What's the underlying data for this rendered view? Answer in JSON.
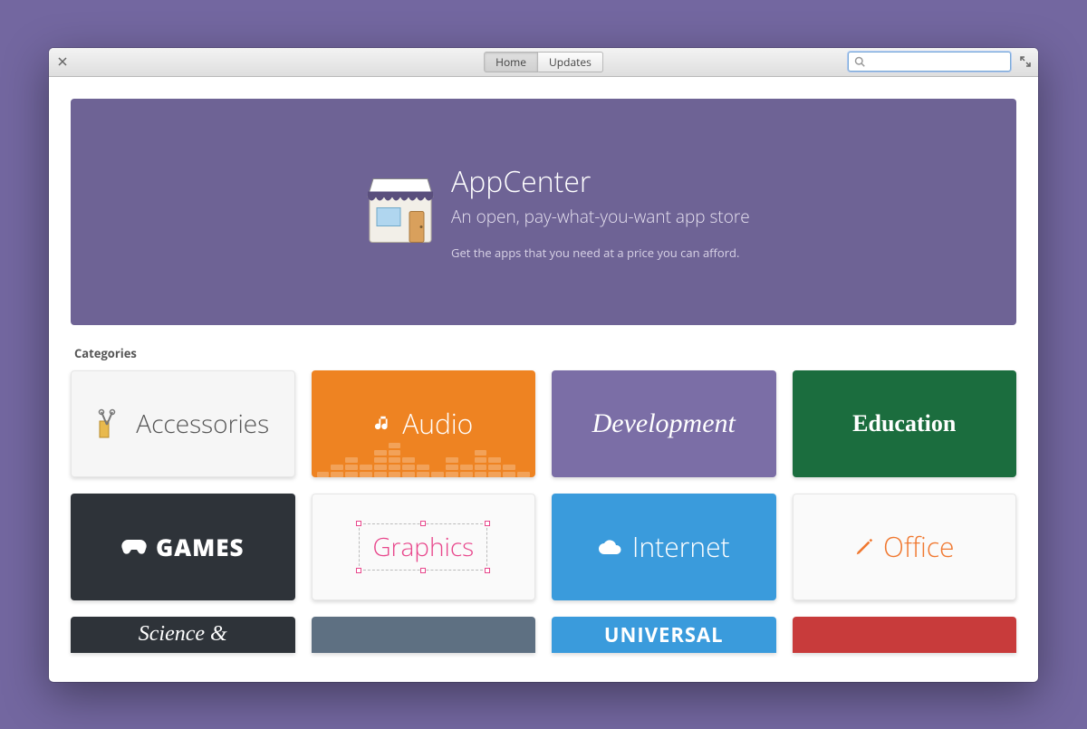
{
  "titlebar": {
    "tabs": {
      "home": "Home",
      "updates": "Updates"
    },
    "search_placeholder": ""
  },
  "banner": {
    "title": "AppCenter",
    "subtitle": "An open, pay-what-you-want app store",
    "desc": "Get the apps that you need at a price you can afford."
  },
  "categories_heading": "Categories",
  "categories": {
    "accessories": "Accessories",
    "audio": "Audio",
    "development": "Development",
    "education": "Education",
    "games": "GAMES",
    "graphics": "Graphics",
    "internet": "Internet",
    "office": "Office",
    "science": "Science &",
    "universal": "UNIVERSAL"
  }
}
